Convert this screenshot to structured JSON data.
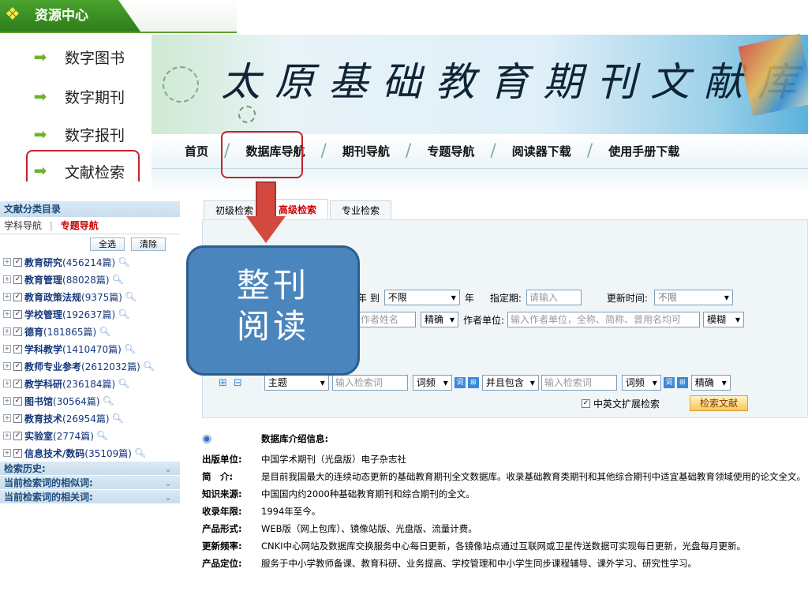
{
  "resource_tab": {
    "title": "资源中心"
  },
  "side_nav": {
    "items": [
      {
        "label": "数字图书"
      },
      {
        "label": "数字期刊"
      },
      {
        "label": "数字报刊"
      },
      {
        "label": "文献检索"
      }
    ]
  },
  "banner": {
    "title": "太原基础教育期刊文献库"
  },
  "menu": {
    "items": [
      {
        "label": "首页"
      },
      {
        "label": "数据库导航"
      },
      {
        "label": "期刊导航"
      },
      {
        "label": "专题导航"
      },
      {
        "label": "阅读器下载"
      },
      {
        "label": "使用手册下载"
      }
    ],
    "separator": "/"
  },
  "left_panel": {
    "header": "文献分类目录",
    "tab_subject": "学科导航",
    "tab_topic": "专题导航",
    "tab_divider": "|",
    "select_all": "全选",
    "clear": "清除",
    "categories": [
      {
        "name": "教育研究",
        "count": "(456214篇)"
      },
      {
        "name": "教育管理",
        "count": "(88028篇)"
      },
      {
        "name": "教育政策法规",
        "count": "(9375篇)"
      },
      {
        "name": "学校管理",
        "count": "(192637篇)"
      },
      {
        "name": "德育",
        "count": "(181865篇)"
      },
      {
        "name": "学科教学",
        "count": "(1410470篇)"
      },
      {
        "name": "教师专业参考",
        "count": "(2612032篇)"
      },
      {
        "name": "教学科研",
        "count": "(236184篇)"
      },
      {
        "name": "图书馆",
        "count": "(30564篇)"
      },
      {
        "name": "教育技术",
        "count": "(26954篇)"
      },
      {
        "name": "实验室",
        "count": "(2774篇)"
      },
      {
        "name": "信息技术/数码",
        "count": "(35109篇)"
      }
    ],
    "footers": [
      "检索历史:",
      "当前检索词的相似词:",
      "当前检索词的相关词:"
    ]
  },
  "search_tabs": [
    "初级检索",
    "高级检索",
    "专业检索"
  ],
  "form": {
    "year_to": "年 到",
    "year_end": "不限",
    "year_suffix": "年",
    "period_label": "指定期:",
    "period_placeholder": "请输入",
    "update_label": "更新时间:",
    "update_value": "不限",
    "author_placeholder": "作者姓名",
    "exact": "精确",
    "author_unit_label": "作者单位:",
    "unit_placeholder": "输入作者单位，全称、简称、曾用名均可",
    "fuzzy": "模糊",
    "field_value": "主题",
    "keyword_placeholder": "输入检索词",
    "freq": "词频",
    "and_contains": "并且包含",
    "keyword2_placeholder": "输入检索词",
    "freq2": "词频",
    "exact2": "精确",
    "bilingual": "中英文扩展检索",
    "search_button": "检索文献",
    "plus": "⊞",
    "minus": "⊟"
  },
  "overlay": {
    "line1": "整刊",
    "line2": "阅读"
  },
  "info": {
    "heading": "数据库介绍信息:",
    "rows": [
      {
        "key": "出版单位:",
        "value": "中国学术期刊（光盘版）电子杂志社"
      },
      {
        "key": "简　介:",
        "value": "是目前我国最大的连续动态更新的基础教育期刊全文数据库。收录基础教育类期刊和其他综合期刊中适宜基础教育领域使用的论文全文。"
      },
      {
        "key": "知识来源:",
        "value": "中国国内约2000种基础教育期刊和综合期刊的全文。"
      },
      {
        "key": "收录年限:",
        "value": "1994年至今。"
      },
      {
        "key": "产品形式:",
        "value": "WEB版（网上包库）、镜像站版、光盘版、流量计费。"
      },
      {
        "key": "更新频率:",
        "value": "CNKI中心网站及数据库交换服务中心每日更新，各镜像站点通过互联网或卫星传送数据可实现每日更新，光盘每月更新。"
      },
      {
        "key": "产品定位:",
        "value": "服务于中小学教师备课、教育科研、业务提高、学校管理和中小学生同步课程辅导、课外学习、研究性学习。"
      }
    ]
  },
  "colors": {
    "accent_green": "#3b8f22",
    "highlight_red": "#c3222c",
    "bubble_blue": "#4b85be",
    "tab_active": "#cc0000"
  }
}
